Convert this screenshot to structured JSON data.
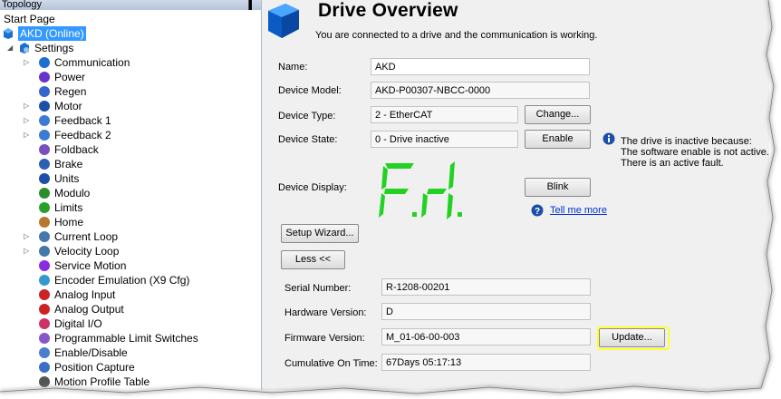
{
  "topology": {
    "title": "Topology",
    "pin_glyph": "▐",
    "start_page": "Start Page",
    "drive_node": "AKD (Online)",
    "settings": "Settings",
    "items": [
      {
        "label": "Communication",
        "icon": "communication-icon",
        "expander": true
      },
      {
        "label": "Power",
        "icon": "power-icon",
        "expander": false
      },
      {
        "label": "Regen",
        "icon": "regen-icon",
        "expander": false
      },
      {
        "label": "Motor",
        "icon": "motor-icon",
        "expander": true
      },
      {
        "label": "Feedback 1",
        "icon": "feedback-1-icon",
        "expander": true
      },
      {
        "label": "Feedback 2",
        "icon": "feedback-2-icon",
        "expander": true
      },
      {
        "label": "Foldback",
        "icon": "foldback-icon",
        "expander": false
      },
      {
        "label": "Brake",
        "icon": "brake-icon",
        "expander": false
      },
      {
        "label": "Units",
        "icon": "units-icon",
        "expander": false
      },
      {
        "label": "Modulo",
        "icon": "modulo-icon",
        "expander": false
      },
      {
        "label": "Limits",
        "icon": "limits-icon",
        "expander": false
      },
      {
        "label": "Home",
        "icon": "home-icon",
        "expander": false
      },
      {
        "label": "Current Loop",
        "icon": "current-loop-icon",
        "expander": true
      },
      {
        "label": "Velocity Loop",
        "icon": "velocity-loop-icon",
        "expander": true
      },
      {
        "label": "Service Motion",
        "icon": "service-motion-icon",
        "expander": false
      },
      {
        "label": "Encoder Emulation (X9 Cfg)",
        "icon": "encoder-emulation-icon",
        "expander": false
      },
      {
        "label": "Analog Input",
        "icon": "analog-input-icon",
        "expander": false
      },
      {
        "label": "Analog Output",
        "icon": "analog-output-icon",
        "expander": false
      },
      {
        "label": "Digital I/O",
        "icon": "digital-io-icon",
        "expander": false
      },
      {
        "label": "Programmable Limit Switches",
        "icon": "limit-switches-icon",
        "expander": false
      },
      {
        "label": "Enable/Disable",
        "icon": "enable-disable-icon",
        "expander": false
      },
      {
        "label": "Position Capture",
        "icon": "position-capture-icon",
        "expander": false
      },
      {
        "label": "Motion Profile Table",
        "icon": "motion-profile-icon",
        "expander": false
      }
    ]
  },
  "overview": {
    "title": "Drive Overview",
    "subtitle": "You are connected to a drive and the communication is working.",
    "name_label": "Name:",
    "name_value": "AKD",
    "model_label": "Device Model:",
    "model_value": "AKD-P00307-NBCC-0000",
    "type_label": "Device Type:",
    "type_value": "2 - EtherCAT",
    "change_btn": "Change...",
    "state_label": "Device State:",
    "state_value": "0 - Drive inactive",
    "enable_btn": "Enable",
    "info_lines": [
      "The drive is inactive because:",
      "The software enable is not active.",
      "There is an active fault."
    ],
    "display_label": "Device Display:",
    "display_text": "F1",
    "blink_btn": "Blink",
    "tell_me_more": "Tell me more",
    "setup_wizard_btn": "Setup Wizard...",
    "less_btn": "Less <<",
    "serial_label": "Serial Number:",
    "serial_value": "R-1208-00201",
    "hw_label": "Hardware Version:",
    "hw_value": "D",
    "fw_label": "Firmware Version:",
    "fw_value": "M_01-06-00-003",
    "update_btn": "Update...",
    "ontime_label": "Cumulative On Time:",
    "ontime_value": "67Days 05:17:13"
  },
  "colors": {
    "selection": "#3399ff",
    "segment_green": "#22d122",
    "highlight": "#ffff33",
    "link": "#0033cc"
  }
}
